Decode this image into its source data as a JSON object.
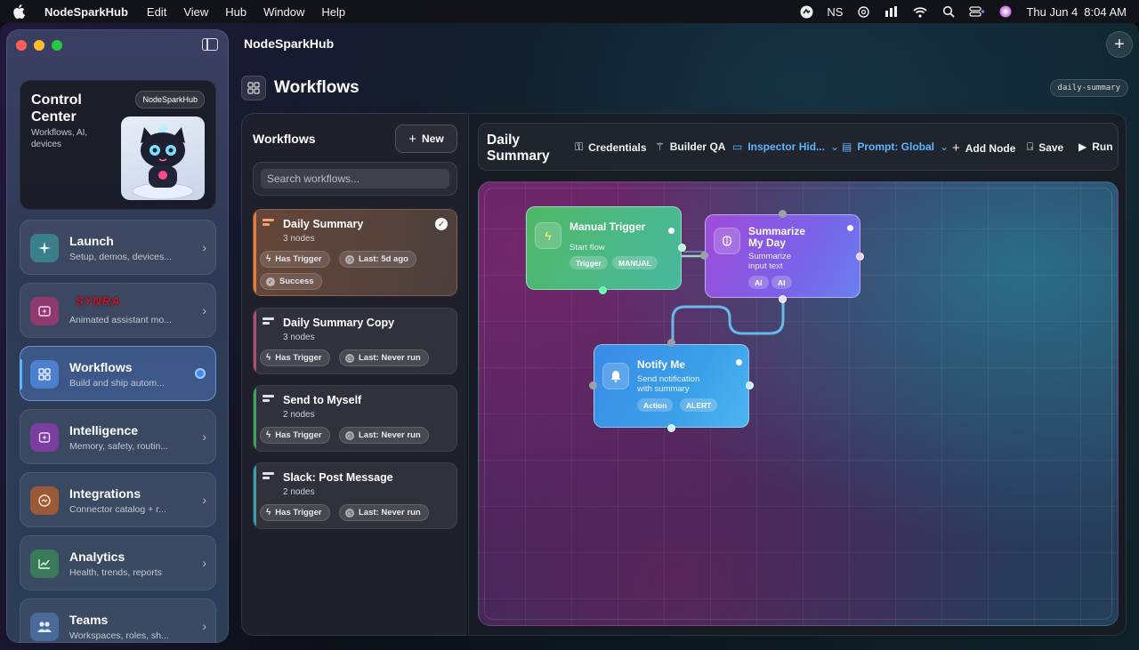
{
  "menubar": {
    "app_name": "NodeSparkHub",
    "menus": [
      "Edit",
      "View",
      "Hub",
      "Window",
      "Help"
    ],
    "status_ns": "NS",
    "clock_date": "Thu Jun 4",
    "clock_time": "8:04 AM"
  },
  "window": {
    "app_title": "NodeSparkHub"
  },
  "sidebar": {
    "control_center": {
      "title": "Control Center",
      "subtitle": "Workflows, AI, devices",
      "chip": "NodeSparkHub"
    },
    "items": [
      {
        "label": "Launch",
        "desc": "Setup, demos, devices...",
        "icon": "sparkle-icon",
        "color": "#3a8f8f"
      },
      {
        "label": "",
        "logo_text": "SYNRA",
        "desc": "Animated assistant mo...",
        "icon": "assistant-icon",
        "color": "#8a3a6a"
      },
      {
        "label": "Workflows",
        "desc": "Build and ship autom...",
        "icon": "grid-icon",
        "color": "#4a78c8",
        "active": true
      },
      {
        "label": "Intelligence",
        "desc": "Memory, safety, routin...",
        "icon": "brain-icon",
        "color": "#7a3a9a"
      },
      {
        "label": "Integrations",
        "desc": "Connector catalog + r...",
        "icon": "connector-icon",
        "color": "#9a5a3a"
      },
      {
        "label": "Analytics",
        "desc": "Health, trends, reports",
        "icon": "chart-icon",
        "color": "#3a7a5a"
      },
      {
        "label": "Teams",
        "desc": "Workspaces, roles, sh...",
        "icon": "people-icon",
        "color": "#4a6a9a"
      }
    ]
  },
  "header": {
    "title": "Workflows",
    "tag": "daily-summary"
  },
  "workflows_panel": {
    "title": "Workflows",
    "new_label": "New",
    "search_placeholder": "Search workflows...",
    "cards": [
      {
        "name": "Daily Summary",
        "nodes": "3 nodes",
        "trigger": "Has Trigger",
        "last": "Last: 5d ago",
        "status": "Success",
        "selected": true
      },
      {
        "name": "Daily Summary Copy",
        "nodes": "3 nodes",
        "trigger": "Has Trigger",
        "last": "Last: Never run"
      },
      {
        "name": "Send to Myself",
        "nodes": "2 nodes",
        "trigger": "Has Trigger",
        "last": "Last: Never run"
      },
      {
        "name": "Slack: Post Message",
        "nodes": "2 nodes",
        "trigger": "Has Trigger",
        "last": "Last: Never run"
      }
    ]
  },
  "editor": {
    "title": "Daily Summary",
    "toolbar": {
      "credentials": "Credentials",
      "builder_qa": "Builder QA",
      "inspector": "Inspector Hid...",
      "prompt": "Prompt: Global",
      "add_node": "Add Node",
      "save": "Save",
      "run": "Run"
    },
    "nodes": {
      "trigger": {
        "title": "Manual Trigger",
        "subtitle": "Start flow",
        "pill1": "Trigger",
        "pill2": "MANUAL"
      },
      "summarize": {
        "title": "Summarize My Day",
        "subtitle": "Summarize input text",
        "pill1": "AI",
        "pill2": "AI"
      },
      "notify": {
        "title": "Notify Me",
        "subtitle": "Send notification with summary",
        "pill1": "Action",
        "pill2": "ALERT"
      }
    }
  },
  "colors": {
    "accent": "#5fb4ff",
    "trigger_node": "#4fb865",
    "ai_node": "#a04bd8",
    "action_node": "#3a8be8"
  }
}
